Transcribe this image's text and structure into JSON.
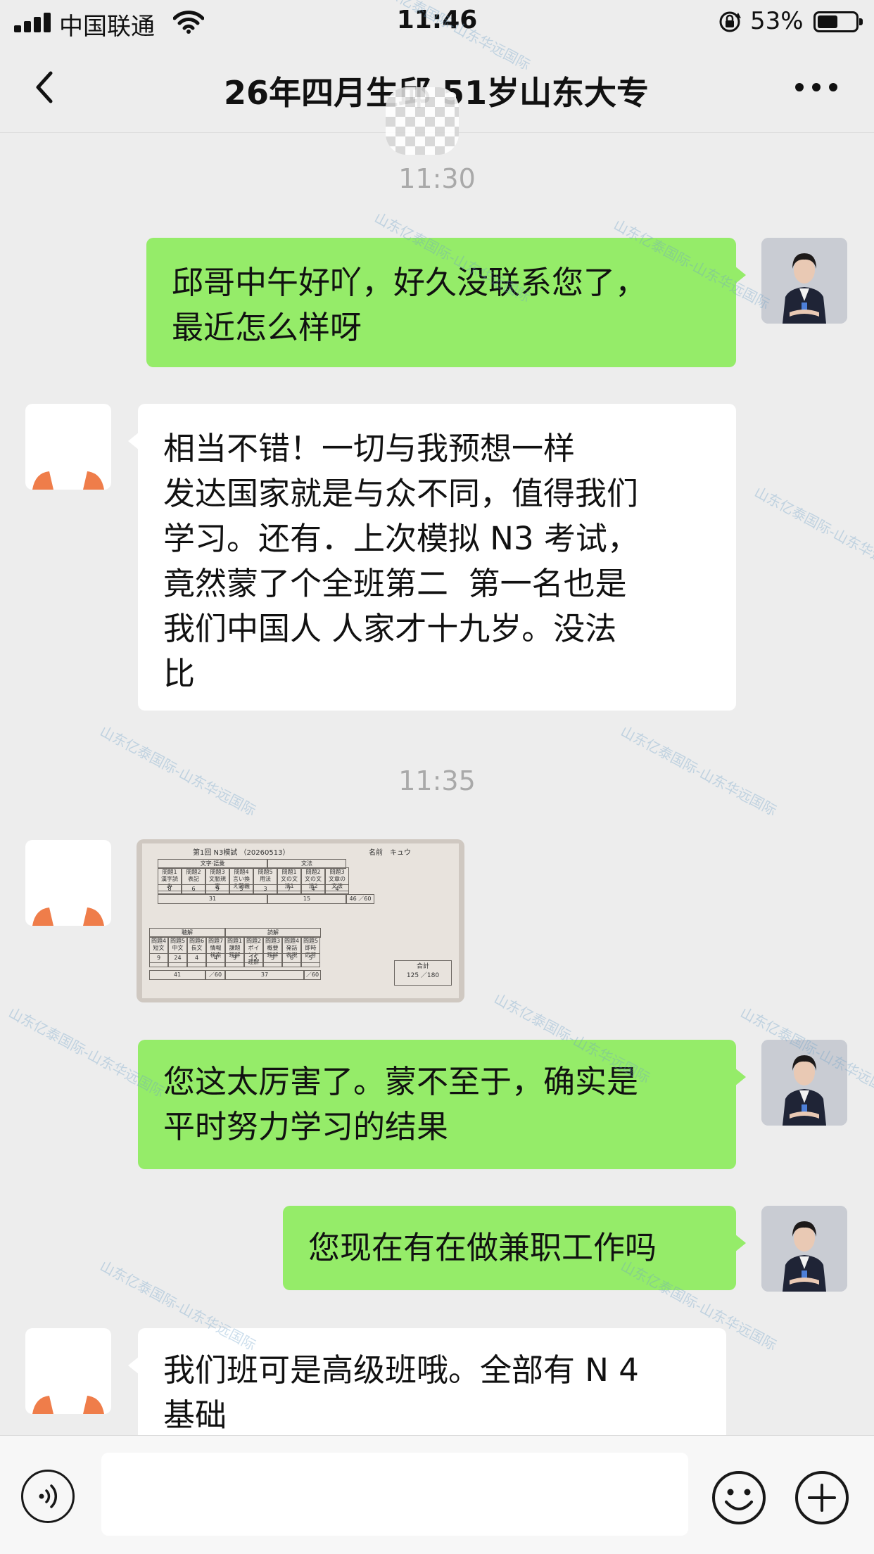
{
  "status_bar": {
    "carrier": "中国联通",
    "time": "11:46",
    "battery_percent": "53%",
    "battery_level": 0.53
  },
  "nav": {
    "title": "26年四月生邱   51岁山东大专",
    "back_icon": "chevron-left-icon",
    "more_icon": "more-dots-icon"
  },
  "messages": [
    {
      "type": "timestamp",
      "text": "11:30"
    },
    {
      "type": "text",
      "side": "self",
      "text": "邱哥中午好吖，好久没联系您了，\n最近怎么样呀"
    },
    {
      "type": "text",
      "side": "other",
      "text": "相当不错！一切与我预想一样\n发达国家就是与众不同，值得我们\n学习。还有．上次模拟 N3 考试，\n竟然蒙了个全班第二  第一名也是\n我们中国人 人家才十九岁。没法\n比"
    },
    {
      "type": "timestamp",
      "text": "11:35"
    },
    {
      "type": "image",
      "side": "other",
      "image": {
        "heading": "第1回  N3模試 （20260513）",
        "name_label": "名前",
        "name_value": "キュウ",
        "section1_header": [
          "文字·語彙",
          "文法"
        ],
        "section1_labels": [
          "問題1 漢字読み",
          "問題2 表記",
          "問題3 文脈規定",
          "問題4 言い換え類義",
          "問題5 用法",
          "問題1 文の文法1",
          "問題2 文の文法2",
          "問題3 文章の文法"
        ],
        "section1_scores": [
          "8",
          "6",
          "9",
          "5",
          "3",
          "7",
          "4",
          "4"
        ],
        "section1_subtotals": [
          "31",
          "15",
          "46 ／60"
        ],
        "section2_header": [
          "聴解",
          "読解"
        ],
        "section2_labels": [
          "問題4 短文",
          "問題5 中文",
          "問題6 長文",
          "問題7 情報検索",
          "問題1 課題理解",
          "問題2 ポイント理解",
          "問題3 概要理解",
          "問題4 発話表現",
          "問題5 即時応答"
        ],
        "section2_scores": [
          "9",
          "24",
          "4",
          "4",
          "9",
          "15",
          "5",
          "6",
          "5"
        ],
        "section2_subtotals": [
          "41",
          "／60",
          "37",
          "／60"
        ],
        "total_label": "合計",
        "total_value": "125 ／180"
      }
    },
    {
      "type": "text",
      "side": "self",
      "text": "您这太厉害了。蒙不至于，确实是\n平时努力学习的结果"
    },
    {
      "type": "text",
      "side": "self",
      "text": "您现在有在做兼职工作吗"
    },
    {
      "type": "text",
      "side": "other",
      "text": "我们班可是高级班哦。全部有 N 4\n基础"
    }
  ],
  "input_bar": {
    "voice_icon": "voice-icon",
    "emoji_icon": "emoji-icon",
    "plus_icon": "plus-icon",
    "draft": ""
  },
  "watermark": "山东亿泰国际-山东华远国际",
  "colors": {
    "background": "#ededed",
    "self_bubble": "#95ec69",
    "other_bubble": "#ffffff",
    "timestamp": "#a9a9a9"
  }
}
